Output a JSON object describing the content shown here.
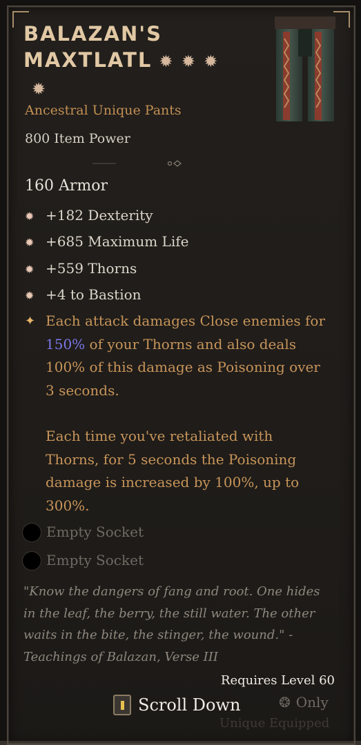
{
  "item": {
    "name_line1": "BALAZAN'S",
    "name_line2": "MAXTLATL",
    "stars": "✹ ✹ ✹",
    "star4": "✹",
    "type": "Ancestral Unique Pants",
    "item_power": "800 Item Power",
    "armor": "160 Armor"
  },
  "stats": [
    {
      "text": "+182 Dexterity"
    },
    {
      "text": "+685 Maximum Life"
    },
    {
      "text": "+559 Thorns"
    },
    {
      "text": "+4 to Bastion"
    }
  ],
  "aspect": {
    "p1_a": "Each attack damages Close enemies for",
    "p1_hl": "150%",
    "p1_b": " of your Thorns and also deals",
    "p1_c": "100% of this damage as Poisoning over",
    "p1_d": "3 seconds.",
    "p2_a": "Each time you've retaliated with",
    "p2_b": "Thorns, for 5 seconds the Poisoning",
    "p2_c": "damage is increased by 100%, up to",
    "p2_d": "300%."
  },
  "sockets": [
    {
      "label": "Empty Socket"
    },
    {
      "label": "Empty Socket"
    }
  ],
  "flavor": {
    "l1": "\"Know the dangers of fang and root. One hides",
    "l2": "in the leaf, the berry, the still water. The other",
    "l3": "waits in the bite, the stinger, the wound.\" -",
    "l4": "Teachings of Balazan, Verse III"
  },
  "requirement": "Requires Level 60",
  "footer": {
    "scroll_label": "Scroll Down",
    "only_label": "Only",
    "unique_equipped": "Unique Equipped"
  },
  "colors": {
    "title": "#e1c8a4",
    "type": "#c28f53",
    "aspect": "#c8955a",
    "highlight": "#7a78e6"
  }
}
